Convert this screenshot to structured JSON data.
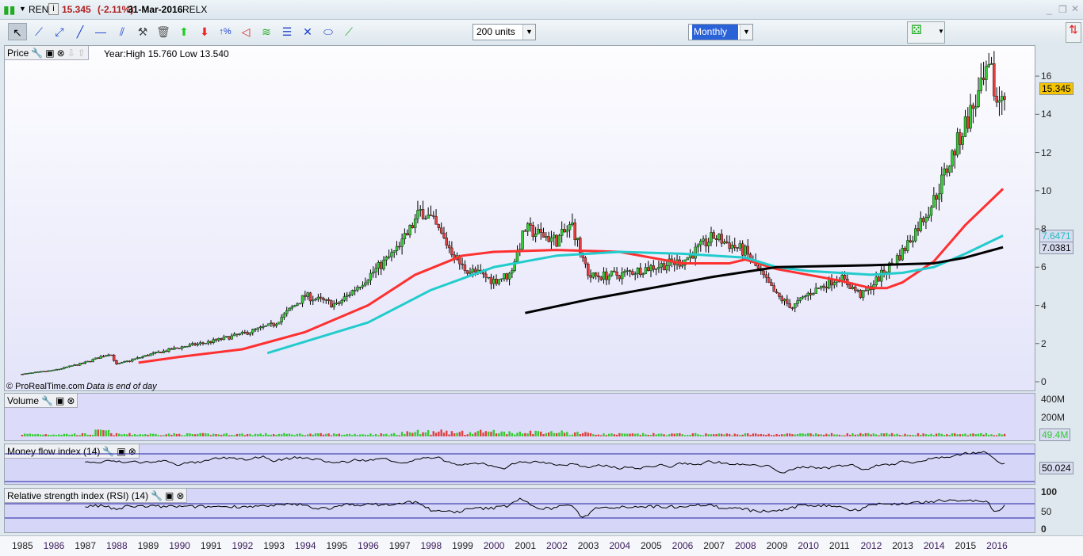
{
  "title_bar": {
    "symbol": "REN",
    "price": "15.345",
    "change": "(-2.11%)",
    "date": "31-Mar-2016",
    "name": "RELX",
    "info_icon": "i"
  },
  "toolbar": {
    "units": "200 units",
    "period": "Monthly",
    "tools": [
      "pointer",
      "segment",
      "two-point",
      "line",
      "horizontal-line",
      "parallel",
      "tools",
      "trash",
      "up-arrow",
      "down-arrow",
      "percent",
      "triangle",
      "channel",
      "fibonacci",
      "pitchfork",
      "ellipse",
      "trendline"
    ]
  },
  "price_panel": {
    "label": "Price",
    "info": "Year:High 15.760 Low 13.540",
    "copyright": "© ProRealTime.com",
    "note": "Data is end of day",
    "last_price": "15.345",
    "ma_cyan": "7.6471",
    "ma_black": "7.0381"
  },
  "volume_panel": {
    "label": "Volume",
    "last": "49.4M",
    "ticks": [
      "400M",
      "200M"
    ]
  },
  "mfi_panel": {
    "label": "Money flow index (14)",
    "last": "50.024"
  },
  "rsi_panel": {
    "label": "Relative strength index (RSI) (14)",
    "ticks": [
      "100",
      "50",
      "0"
    ]
  },
  "colors": {
    "up": "#33cc33",
    "down": "#e04040",
    "ma_red": "#ff3030",
    "ma_cyan": "#22cccc",
    "ma_black": "#000000",
    "tag_yellow": "#f5c400"
  },
  "chart_data": {
    "type": "line",
    "title": "REN monthly candlestick",
    "x_ticks": [
      "1985",
      "1986",
      "1987",
      "1988",
      "1989",
      "1990",
      "1991",
      "1992",
      "1993",
      "1994",
      "1995",
      "1996",
      "1997",
      "1998",
      "1999",
      "2000",
      "2001",
      "2002",
      "2003",
      "2004",
      "2005",
      "2006",
      "2007",
      "2008",
      "2009",
      "2010",
      "2011",
      "2012",
      "2013",
      "2014",
      "2015",
      "2016"
    ],
    "y_ticks": [
      "0",
      "2",
      "4",
      "6",
      "8",
      "10",
      "12",
      "14",
      "16"
    ],
    "ylim": [
      0,
      16.5
    ],
    "price_path": [
      [
        1985,
        0.4
      ],
      [
        1986,
        0.6
      ],
      [
        1987,
        1.0
      ],
      [
        1987.8,
        1.5
      ],
      [
        1988,
        0.9
      ],
      [
        1989,
        1.4
      ],
      [
        1990,
        1.8
      ],
      [
        1991,
        2.1
      ],
      [
        1992,
        2.5
      ],
      [
        1993,
        3.0
      ],
      [
        1994,
        4.5
      ],
      [
        1995,
        4.0
      ],
      [
        1996,
        5.5
      ],
      [
        1997,
        7.0
      ],
      [
        1997.7,
        9.0
      ],
      [
        1998,
        8.5
      ],
      [
        1999,
        6.0
      ],
      [
        2000,
        5.3
      ],
      [
        2000.5,
        5.6
      ],
      [
        2001,
        8.0
      ],
      [
        2002,
        7.4
      ],
      [
        2002.5,
        8.2
      ],
      [
        2003,
        5.5
      ],
      [
        2004,
        5.6
      ],
      [
        2005,
        6.0
      ],
      [
        2006,
        6.3
      ],
      [
        2007,
        7.6
      ],
      [
        2008,
        6.8
      ],
      [
        2009,
        4.5
      ],
      [
        2009.5,
        3.9
      ],
      [
        2010,
        4.6
      ],
      [
        2011,
        5.5
      ],
      [
        2011.7,
        4.5
      ],
      [
        2012,
        5.0
      ],
      [
        2013,
        6.8
      ],
      [
        2014,
        9.5
      ],
      [
        2015,
        13.5
      ],
      [
        2015.8,
        16.3
      ],
      [
        2016,
        14.6
      ],
      [
        2016.25,
        15.345
      ]
    ],
    "series": [
      {
        "name": "MA red",
        "color": "#ff3030",
        "points": [
          [
            1988.7,
            1.0
          ],
          [
            1990,
            1.3
          ],
          [
            1992,
            1.7
          ],
          [
            1994,
            2.6
          ],
          [
            1996,
            4.0
          ],
          [
            1997.5,
            5.6
          ],
          [
            1999,
            6.6
          ],
          [
            2000,
            6.8
          ],
          [
            2002,
            6.9
          ],
          [
            2004,
            6.8
          ],
          [
            2006,
            6.2
          ],
          [
            2007.5,
            6.2
          ],
          [
            2008,
            6.4
          ],
          [
            2009,
            5.9
          ],
          [
            2010,
            5.6
          ],
          [
            2011,
            5.3
          ],
          [
            2012,
            4.9
          ],
          [
            2012.5,
            4.9
          ],
          [
            2013,
            5.2
          ],
          [
            2014,
            6.3
          ],
          [
            2015,
            8.2
          ],
          [
            2016.2,
            10.1
          ]
        ]
      },
      {
        "name": "MA cyan",
        "color": "#22cccc",
        "points": [
          [
            1992.8,
            1.5
          ],
          [
            1994,
            2.1
          ],
          [
            1996,
            3.1
          ],
          [
            1998,
            4.8
          ],
          [
            2000,
            6.0
          ],
          [
            2002,
            6.6
          ],
          [
            2004,
            6.8
          ],
          [
            2006,
            6.7
          ],
          [
            2008,
            6.5
          ],
          [
            2009,
            6.0
          ],
          [
            2010,
            5.8
          ],
          [
            2011,
            5.7
          ],
          [
            2012,
            5.6
          ],
          [
            2013,
            5.7
          ],
          [
            2014,
            6.0
          ],
          [
            2015,
            6.7
          ],
          [
            2016.2,
            7.65
          ]
        ]
      },
      {
        "name": "MA black",
        "color": "#000000",
        "points": [
          [
            2001,
            3.6
          ],
          [
            2003,
            4.3
          ],
          [
            2005,
            4.9
          ],
          [
            2007,
            5.5
          ],
          [
            2009,
            6.0
          ],
          [
            2012,
            6.1
          ],
          [
            2014,
            6.2
          ],
          [
            2015,
            6.5
          ],
          [
            2016.2,
            7.04
          ]
        ]
      }
    ]
  }
}
